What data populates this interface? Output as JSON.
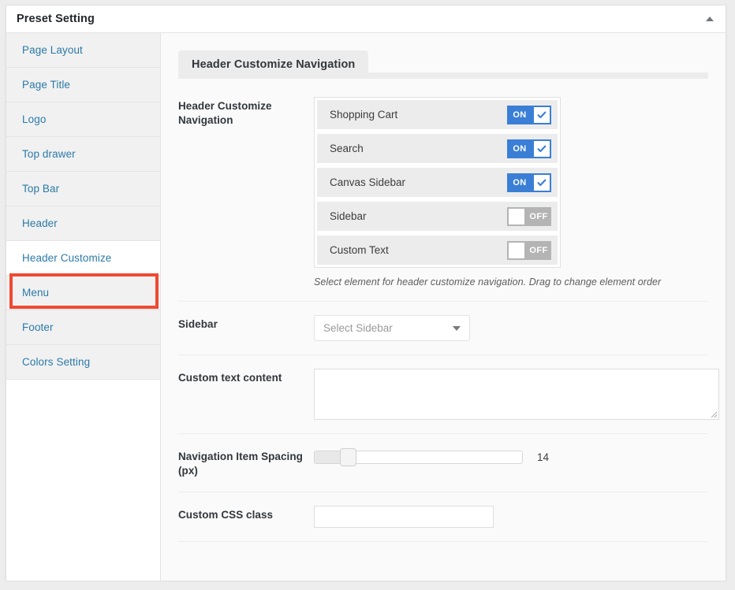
{
  "window": {
    "title": "Preset Setting",
    "collapse_icon": "caret-up-icon"
  },
  "sidebar": {
    "items": [
      {
        "label": "Page Layout",
        "active": false
      },
      {
        "label": "Page Title",
        "active": false
      },
      {
        "label": "Logo",
        "active": false
      },
      {
        "label": "Top drawer",
        "active": false
      },
      {
        "label": "Top Bar",
        "active": false
      },
      {
        "label": "Header",
        "active": false
      },
      {
        "label": "Header Customize",
        "active": true
      },
      {
        "label": "Menu",
        "active": false
      },
      {
        "label": "Footer",
        "active": false
      },
      {
        "label": "Colors Setting",
        "active": false
      }
    ],
    "highlight_color": "#f04a32"
  },
  "tab": {
    "label": "Header Customize Navigation"
  },
  "fields": {
    "nav_elements": {
      "label": "Header Customize Navigation",
      "help": "Select element for header customize navigation. Drag to change element order",
      "items": [
        {
          "label": "Shopping Cart",
          "state": "ON"
        },
        {
          "label": "Search",
          "state": "ON"
        },
        {
          "label": "Canvas Sidebar",
          "state": "ON"
        },
        {
          "label": "Sidebar",
          "state": "OFF"
        },
        {
          "label": "Custom Text",
          "state": "OFF"
        }
      ]
    },
    "sidebar_select": {
      "label": "Sidebar",
      "value": "Select Sidebar",
      "caret_icon": "caret-down-icon"
    },
    "custom_text": {
      "label": "Custom text content",
      "value": "",
      "resize_icon": "resize-grip-icon"
    },
    "item_spacing": {
      "label": "Navigation Item Spacing (px)",
      "value": "14",
      "min": "0",
      "max": "100"
    },
    "css_class": {
      "label": "Custom CSS class",
      "value": ""
    }
  },
  "colors": {
    "toggle_on": "#3a7fd5",
    "toggle_off": "#b4b4b4",
    "link": "#2a7aa8",
    "highlight": "#f04a32"
  }
}
